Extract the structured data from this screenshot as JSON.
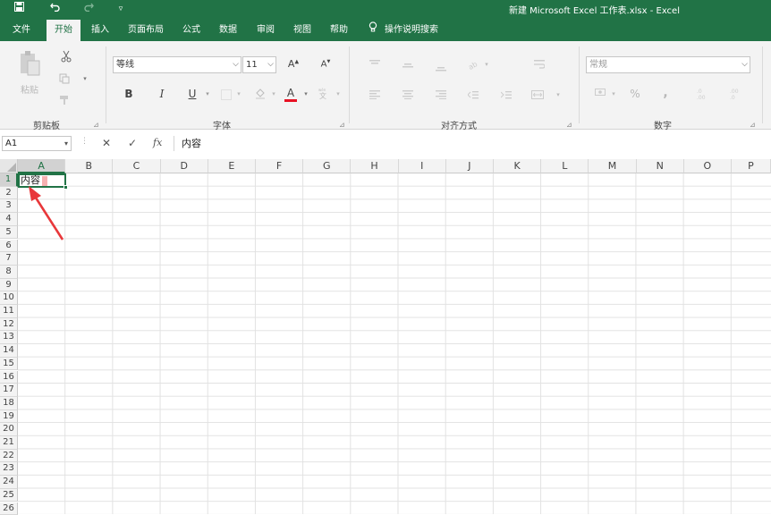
{
  "titlebar": {
    "save_icon": "save-icon",
    "undo_icon": "undo-icon",
    "redo_icon": "redo-icon",
    "customize_icon": "customize-qat-icon",
    "title": "新建 Microsoft Excel 工作表.xlsx  -  Excel"
  },
  "tabs": [
    {
      "label": "文件"
    },
    {
      "label": "开始"
    },
    {
      "label": "插入"
    },
    {
      "label": "页面布局"
    },
    {
      "label": "公式"
    },
    {
      "label": "数据"
    },
    {
      "label": "审阅"
    },
    {
      "label": "视图"
    },
    {
      "label": "帮助"
    }
  ],
  "active_tab": "开始",
  "tell_me": "操作说明搜索",
  "ribbon": {
    "clipboard": {
      "label": "剪贴板",
      "paste_label": "粘贴"
    },
    "font": {
      "label": "字体",
      "font_name": "等线",
      "font_size": "11",
      "increase": "A",
      "decrease": "A",
      "bold": "B",
      "italic": "I",
      "underline": "U",
      "font_color_letter": "A",
      "font_color": "#e81123"
    },
    "alignment": {
      "label": "对齐方式"
    },
    "number": {
      "label": "数字",
      "format": "常规",
      "percent": "%",
      "comma": ","
    }
  },
  "formula_bar": {
    "name_box": "A1",
    "cancel": "✕",
    "enter": "✓",
    "fx": "fx",
    "content": "内容"
  },
  "grid": {
    "columns": [
      "A",
      "B",
      "C",
      "D",
      "E",
      "F",
      "G",
      "H",
      "I",
      "J",
      "K",
      "L",
      "M",
      "N",
      "O",
      "P"
    ],
    "rows": [
      "1",
      "2",
      "3",
      "4",
      "5",
      "6",
      "7",
      "8",
      "9",
      "10",
      "11",
      "12",
      "13",
      "14",
      "15",
      "16",
      "17",
      "18",
      "19",
      "20",
      "21",
      "22",
      "23",
      "24",
      "25",
      "26"
    ],
    "selected_col": "A",
    "selected_row": "1",
    "a1_value": "内容"
  },
  "colors": {
    "accent": "#217346",
    "annotation": "#e8373a"
  }
}
